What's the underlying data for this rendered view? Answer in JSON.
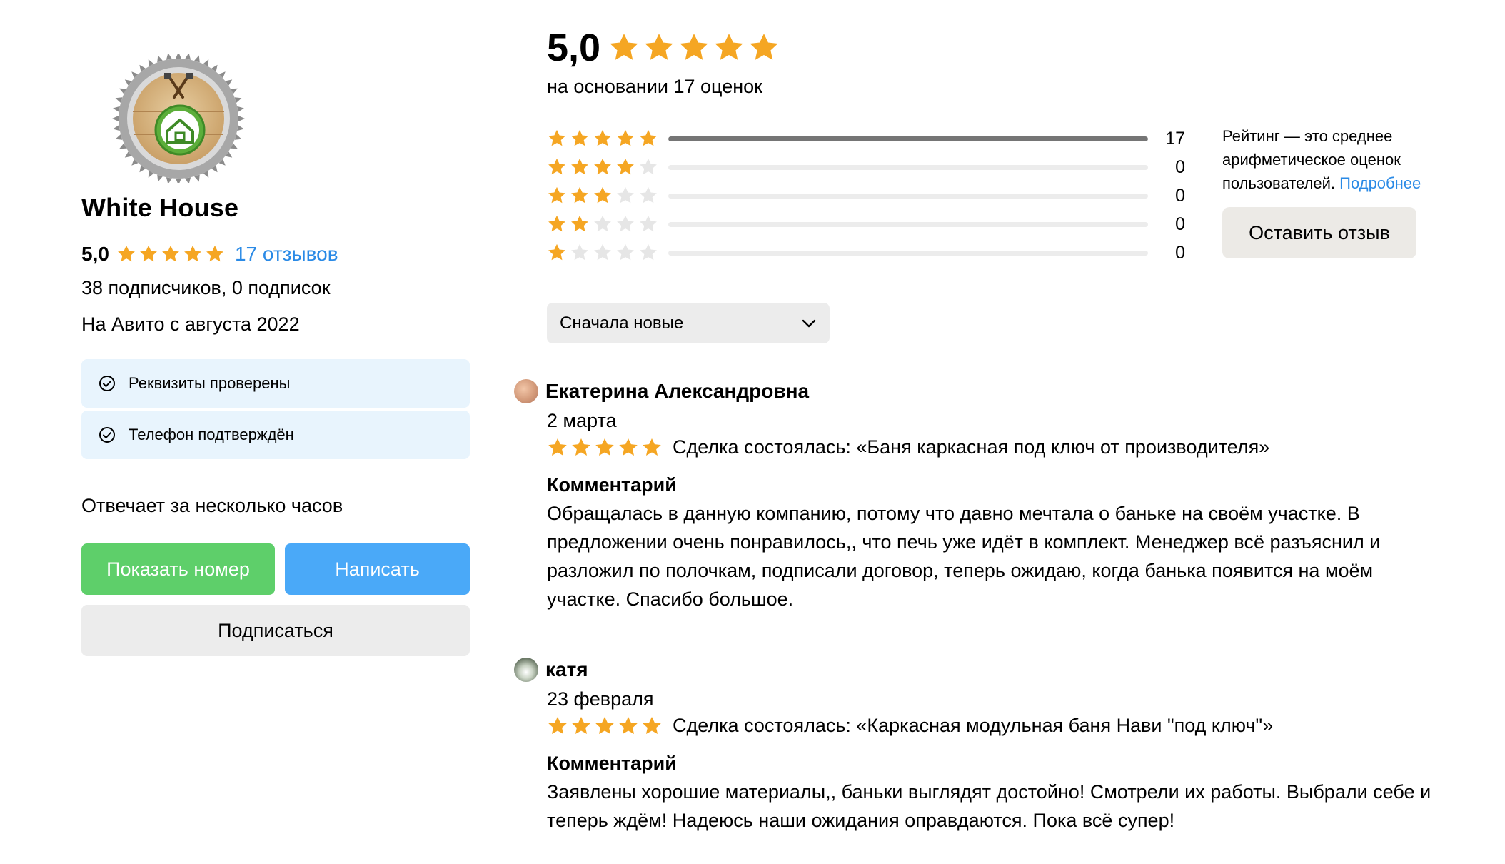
{
  "colors": {
    "star_filled": "#f5a623",
    "star_empty": "#e6e6e6",
    "link": "#2a8ae6",
    "green_button": "#5ecf6a",
    "blue_button": "#4aa9f8",
    "badge_bg": "#e8f4fd"
  },
  "seller": {
    "name": "White House",
    "rating": "5,0",
    "stars": 5,
    "reviews_link": "17 отзывов",
    "subscribers": "38 подписчиков, 0 подписок",
    "since": "На Авито с августа 2022",
    "badges": [
      {
        "label": "Реквизиты проверены",
        "icon": "check-circle-icon"
      },
      {
        "label": "Телефон подтверждён",
        "icon": "check-circle-icon"
      }
    ],
    "reply_time": "Отвечает за несколько часов",
    "buttons": {
      "show_number": "Показать номер",
      "write": "Написать",
      "subscribe": "Подписаться"
    }
  },
  "summary": {
    "score": "5,0",
    "stars": 5,
    "based_on": "на основании 17 оценок",
    "breakdown": [
      {
        "stars": 5,
        "count": "17",
        "fraction": 1.0
      },
      {
        "stars": 4,
        "count": "0",
        "fraction": 0
      },
      {
        "stars": 3,
        "count": "0",
        "fraction": 0
      },
      {
        "stars": 2,
        "count": "0",
        "fraction": 0
      },
      {
        "stars": 1,
        "count": "0",
        "fraction": 0
      }
    ],
    "note_text": "Рейтинг — это среднее арифметическое оценок пользователей.",
    "note_link": "Подробнее",
    "leave_review": "Оставить отзыв"
  },
  "sort": {
    "selected": "Сначала новые",
    "icon": "chevron-down-icon"
  },
  "reviews": [
    {
      "author": "Екатерина Александровна",
      "date": "2 марта",
      "stars": 5,
      "deal": "Сделка состоялась: «Баня каркасная под ключ от производителя»",
      "comment_label": "Комментарий",
      "comment": "Обращалась в данную компанию, потому что давно мечтала о баньке на своём участке. В предложении очень понравилось,, что печь уже идёт в комплект. Менеджер всё разъяснил и разложил по полочкам, подписали договор, теперь ожидаю, когда банька появится на моём участке. Спасибо большое."
    },
    {
      "author": "катя",
      "date": "23 февраля",
      "stars": 5,
      "deal": "Сделка состоялась: «Каркасная модульная баня Нави \"под ключ\"»",
      "comment_label": "Комментарий",
      "comment": "Заявлены хорошие материалы,, баньки выглядят достойно! Смотрели их работы. Выбрали себе и теперь ждём! Надеюсь наши ожидания оправдаются. Пока всё супер!"
    }
  ]
}
